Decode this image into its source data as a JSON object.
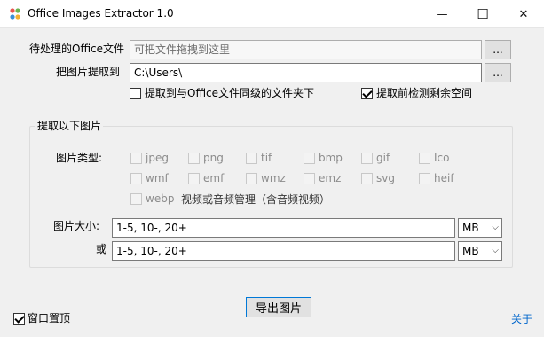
{
  "window": {
    "title": "Office Images Extractor 1.0",
    "minimize_glyph": "—",
    "maximize_glyph": "☐",
    "close_glyph": "✕"
  },
  "source": {
    "label": "待处理的Office文件",
    "placeholder": "可把文件拖拽到这里",
    "browse_label": "..."
  },
  "target": {
    "label": "把图片提取到",
    "value": "C:\\Users\\",
    "browse_label": "..."
  },
  "options": {
    "extract_to_same_folder": {
      "label": "提取到与Office文件同级的文件夹下",
      "checked": false
    },
    "check_free_space": {
      "label": "提取前检测剩余空间",
      "checked": true
    }
  },
  "extract_group": {
    "title": "提取以下图片",
    "types_label": "图片类型:",
    "types": [
      {
        "label": "jpeg",
        "checked": false
      },
      {
        "label": "png",
        "checked": false
      },
      {
        "label": "tif",
        "checked": false
      },
      {
        "label": "bmp",
        "checked": false
      },
      {
        "label": "gif",
        "checked": false
      },
      {
        "label": "Ico",
        "checked": false
      },
      {
        "label": "wmf",
        "checked": false
      },
      {
        "label": "emf",
        "checked": false
      },
      {
        "label": "wmz",
        "checked": false
      },
      {
        "label": "emz",
        "checked": false
      },
      {
        "label": "svg",
        "checked": false
      },
      {
        "label": "heif",
        "checked": false
      },
      {
        "label": "webp",
        "checked": false
      }
    ],
    "media_label": "视频或音频管理（含音频视频）",
    "size_label": "图片大小:",
    "size_value_1": "1-5, 10-, 20+",
    "unit_1": "MB",
    "or_label": "或",
    "size_value_2": "1-5, 10-, 20+",
    "unit_2": "MB"
  },
  "footer": {
    "topmost_label": "窗口置顶",
    "topmost_checked": true,
    "export_label": "导出图片",
    "about_label": "关于"
  },
  "colors": {
    "accent": "#0078d7",
    "link": "#0066cc",
    "window_bg": "#f0f0f0"
  }
}
